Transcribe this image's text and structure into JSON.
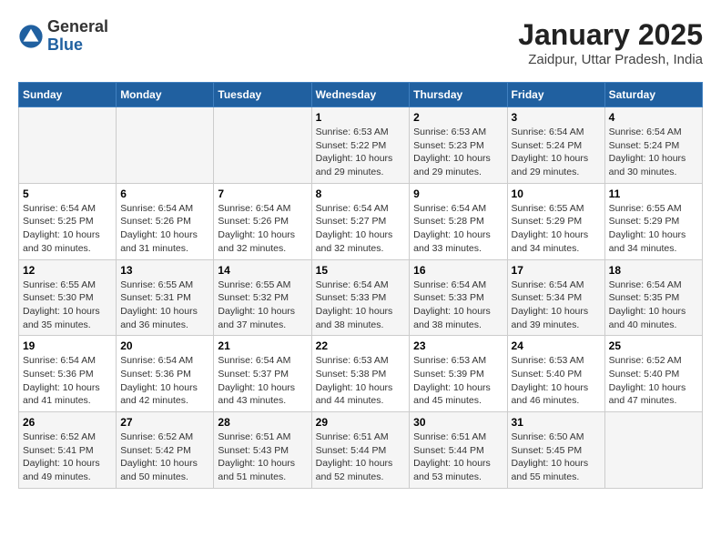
{
  "header": {
    "logo_general": "General",
    "logo_blue": "Blue",
    "month_title": "January 2025",
    "location": "Zaidpur, Uttar Pradesh, India"
  },
  "columns": [
    "Sunday",
    "Monday",
    "Tuesday",
    "Wednesday",
    "Thursday",
    "Friday",
    "Saturday"
  ],
  "weeks": [
    [
      {
        "day": "",
        "sunrise": "",
        "sunset": "",
        "daylight": ""
      },
      {
        "day": "",
        "sunrise": "",
        "sunset": "",
        "daylight": ""
      },
      {
        "day": "",
        "sunrise": "",
        "sunset": "",
        "daylight": ""
      },
      {
        "day": "1",
        "sunrise": "Sunrise: 6:53 AM",
        "sunset": "Sunset: 5:22 PM",
        "daylight": "Daylight: 10 hours and 29 minutes."
      },
      {
        "day": "2",
        "sunrise": "Sunrise: 6:53 AM",
        "sunset": "Sunset: 5:23 PM",
        "daylight": "Daylight: 10 hours and 29 minutes."
      },
      {
        "day": "3",
        "sunrise": "Sunrise: 6:54 AM",
        "sunset": "Sunset: 5:24 PM",
        "daylight": "Daylight: 10 hours and 29 minutes."
      },
      {
        "day": "4",
        "sunrise": "Sunrise: 6:54 AM",
        "sunset": "Sunset: 5:24 PM",
        "daylight": "Daylight: 10 hours and 30 minutes."
      }
    ],
    [
      {
        "day": "5",
        "sunrise": "Sunrise: 6:54 AM",
        "sunset": "Sunset: 5:25 PM",
        "daylight": "Daylight: 10 hours and 30 minutes."
      },
      {
        "day": "6",
        "sunrise": "Sunrise: 6:54 AM",
        "sunset": "Sunset: 5:26 PM",
        "daylight": "Daylight: 10 hours and 31 minutes."
      },
      {
        "day": "7",
        "sunrise": "Sunrise: 6:54 AM",
        "sunset": "Sunset: 5:26 PM",
        "daylight": "Daylight: 10 hours and 32 minutes."
      },
      {
        "day": "8",
        "sunrise": "Sunrise: 6:54 AM",
        "sunset": "Sunset: 5:27 PM",
        "daylight": "Daylight: 10 hours and 32 minutes."
      },
      {
        "day": "9",
        "sunrise": "Sunrise: 6:54 AM",
        "sunset": "Sunset: 5:28 PM",
        "daylight": "Daylight: 10 hours and 33 minutes."
      },
      {
        "day": "10",
        "sunrise": "Sunrise: 6:55 AM",
        "sunset": "Sunset: 5:29 PM",
        "daylight": "Daylight: 10 hours and 34 minutes."
      },
      {
        "day": "11",
        "sunrise": "Sunrise: 6:55 AM",
        "sunset": "Sunset: 5:29 PM",
        "daylight": "Daylight: 10 hours and 34 minutes."
      }
    ],
    [
      {
        "day": "12",
        "sunrise": "Sunrise: 6:55 AM",
        "sunset": "Sunset: 5:30 PM",
        "daylight": "Daylight: 10 hours and 35 minutes."
      },
      {
        "day": "13",
        "sunrise": "Sunrise: 6:55 AM",
        "sunset": "Sunset: 5:31 PM",
        "daylight": "Daylight: 10 hours and 36 minutes."
      },
      {
        "day": "14",
        "sunrise": "Sunrise: 6:55 AM",
        "sunset": "Sunset: 5:32 PM",
        "daylight": "Daylight: 10 hours and 37 minutes."
      },
      {
        "day": "15",
        "sunrise": "Sunrise: 6:54 AM",
        "sunset": "Sunset: 5:33 PM",
        "daylight": "Daylight: 10 hours and 38 minutes."
      },
      {
        "day": "16",
        "sunrise": "Sunrise: 6:54 AM",
        "sunset": "Sunset: 5:33 PM",
        "daylight": "Daylight: 10 hours and 38 minutes."
      },
      {
        "day": "17",
        "sunrise": "Sunrise: 6:54 AM",
        "sunset": "Sunset: 5:34 PM",
        "daylight": "Daylight: 10 hours and 39 minutes."
      },
      {
        "day": "18",
        "sunrise": "Sunrise: 6:54 AM",
        "sunset": "Sunset: 5:35 PM",
        "daylight": "Daylight: 10 hours and 40 minutes."
      }
    ],
    [
      {
        "day": "19",
        "sunrise": "Sunrise: 6:54 AM",
        "sunset": "Sunset: 5:36 PM",
        "daylight": "Daylight: 10 hours and 41 minutes."
      },
      {
        "day": "20",
        "sunrise": "Sunrise: 6:54 AM",
        "sunset": "Sunset: 5:36 PM",
        "daylight": "Daylight: 10 hours and 42 minutes."
      },
      {
        "day": "21",
        "sunrise": "Sunrise: 6:54 AM",
        "sunset": "Sunset: 5:37 PM",
        "daylight": "Daylight: 10 hours and 43 minutes."
      },
      {
        "day": "22",
        "sunrise": "Sunrise: 6:53 AM",
        "sunset": "Sunset: 5:38 PM",
        "daylight": "Daylight: 10 hours and 44 minutes."
      },
      {
        "day": "23",
        "sunrise": "Sunrise: 6:53 AM",
        "sunset": "Sunset: 5:39 PM",
        "daylight": "Daylight: 10 hours and 45 minutes."
      },
      {
        "day": "24",
        "sunrise": "Sunrise: 6:53 AM",
        "sunset": "Sunset: 5:40 PM",
        "daylight": "Daylight: 10 hours and 46 minutes."
      },
      {
        "day": "25",
        "sunrise": "Sunrise: 6:52 AM",
        "sunset": "Sunset: 5:40 PM",
        "daylight": "Daylight: 10 hours and 47 minutes."
      }
    ],
    [
      {
        "day": "26",
        "sunrise": "Sunrise: 6:52 AM",
        "sunset": "Sunset: 5:41 PM",
        "daylight": "Daylight: 10 hours and 49 minutes."
      },
      {
        "day": "27",
        "sunrise": "Sunrise: 6:52 AM",
        "sunset": "Sunset: 5:42 PM",
        "daylight": "Daylight: 10 hours and 50 minutes."
      },
      {
        "day": "28",
        "sunrise": "Sunrise: 6:51 AM",
        "sunset": "Sunset: 5:43 PM",
        "daylight": "Daylight: 10 hours and 51 minutes."
      },
      {
        "day": "29",
        "sunrise": "Sunrise: 6:51 AM",
        "sunset": "Sunset: 5:44 PM",
        "daylight": "Daylight: 10 hours and 52 minutes."
      },
      {
        "day": "30",
        "sunrise": "Sunrise: 6:51 AM",
        "sunset": "Sunset: 5:44 PM",
        "daylight": "Daylight: 10 hours and 53 minutes."
      },
      {
        "day": "31",
        "sunrise": "Sunrise: 6:50 AM",
        "sunset": "Sunset: 5:45 PM",
        "daylight": "Daylight: 10 hours and 55 minutes."
      },
      {
        "day": "",
        "sunrise": "",
        "sunset": "",
        "daylight": ""
      }
    ]
  ]
}
